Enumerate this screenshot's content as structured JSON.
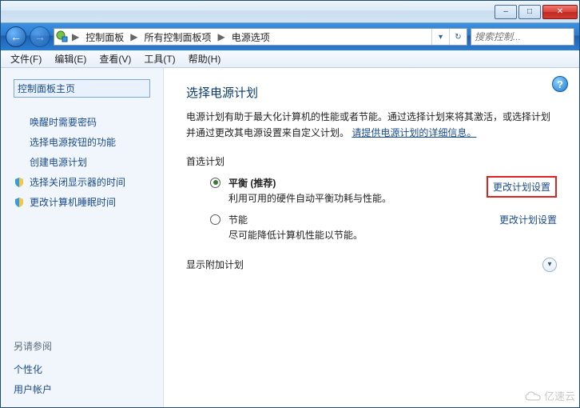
{
  "window_controls": {
    "minimize": "–",
    "maximize": "□",
    "close": "✕"
  },
  "nav": {
    "back": "←",
    "forward": "→"
  },
  "breadcrumb": {
    "seg1": "控制面板",
    "seg2": "所有控制面板项",
    "seg3": "电源选项",
    "sep": "▶"
  },
  "search": {
    "placeholder": "搜索控制...",
    "icon": "🔍"
  },
  "menubar": {
    "file": "文件(F)",
    "edit": "编辑(E)",
    "view": "查看(V)",
    "tools": "工具(T)",
    "help": "帮助(H)"
  },
  "sidebar": {
    "home": "控制面板主页",
    "links": [
      "唤醒时需要密码",
      "选择电源按钮的功能",
      "创建电源计划",
      "选择关闭显示器的时间",
      "更改计算机睡眠时间"
    ],
    "see_also_head": "另请参阅",
    "see_also": [
      "个性化",
      "用户帐户"
    ]
  },
  "content": {
    "title": "选择电源计划",
    "desc_prefix": "电源计划有助于最大化计算机的性能或者节能。通过选择计划来将其激活，或选择计划并通过更改其电源设置来自定义计划。",
    "desc_link": "请提供电源计划的详细信息。",
    "preferred_head": "首选计划",
    "plans": [
      {
        "name": "平衡 (推荐)",
        "desc": "利用可用的硬件自动平衡功耗与性能。",
        "link": "更改计划设置",
        "checked": true,
        "boxed": true
      },
      {
        "name": "节能",
        "desc": "尽可能降低计算机性能以节能。",
        "link": "更改计划设置",
        "checked": false,
        "boxed": false
      }
    ],
    "expander": "显示附加计划"
  },
  "watermark": "亿速云"
}
